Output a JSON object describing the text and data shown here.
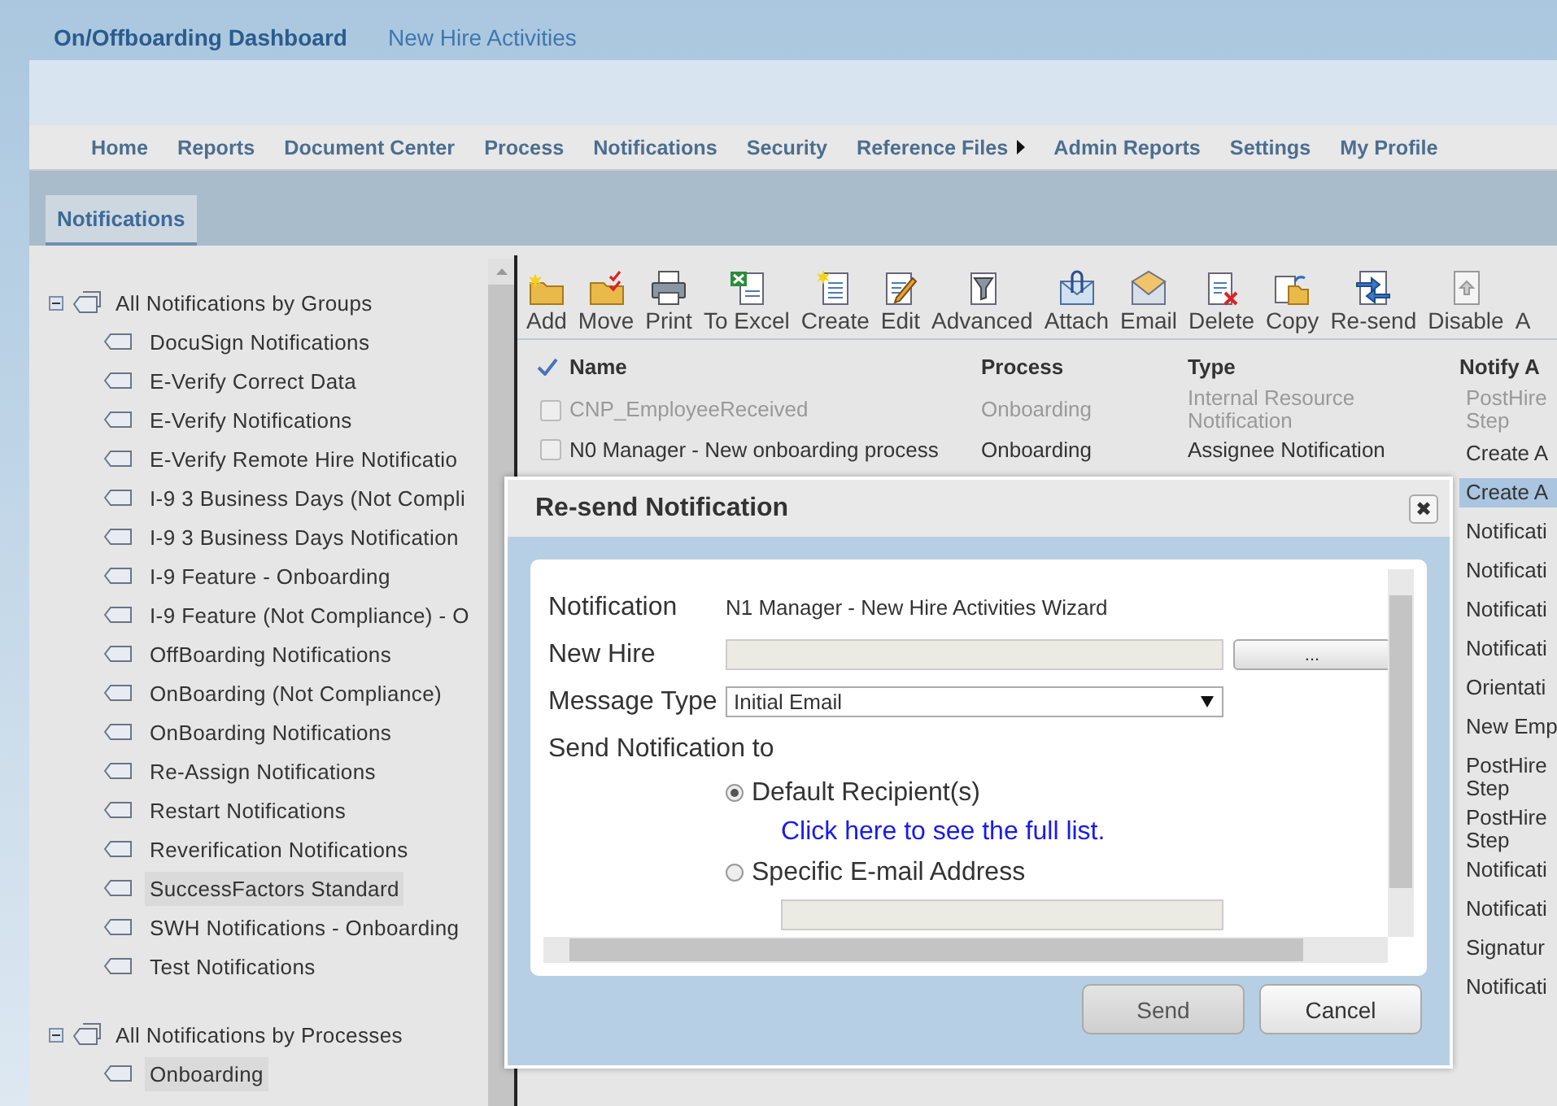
{
  "header": {
    "title": "On/Offboarding Dashboard",
    "subtitle": "New Hire Activities"
  },
  "nav": [
    {
      "label": "Home",
      "submenu": false
    },
    {
      "label": "Reports",
      "submenu": false
    },
    {
      "label": "Document Center",
      "submenu": false
    },
    {
      "label": "Process",
      "submenu": false
    },
    {
      "label": "Notifications",
      "submenu": false
    },
    {
      "label": "Security",
      "submenu": false
    },
    {
      "label": "Reference Files",
      "submenu": true
    },
    {
      "label": "Admin Reports",
      "submenu": false
    },
    {
      "label": "Settings",
      "submenu": false
    },
    {
      "label": "My Profile",
      "submenu": false
    }
  ],
  "tabs": [
    {
      "label": "Notifications",
      "selected": true
    }
  ],
  "tree": [
    {
      "label": "All Notifications by Groups",
      "expanded": true,
      "selected": false,
      "children": [
        {
          "label": "DocuSign Notifications",
          "selected": false
        },
        {
          "label": "E-Verify Correct Data",
          "selected": false
        },
        {
          "label": "E-Verify Notifications",
          "selected": false
        },
        {
          "label": "E-Verify Remote Hire Notificatio",
          "selected": false
        },
        {
          "label": "I-9 3 Business Days (Not Compli",
          "selected": false
        },
        {
          "label": "I-9 3 Business Days Notification",
          "selected": false
        },
        {
          "label": "I-9 Feature - Onboarding",
          "selected": false
        },
        {
          "label": "I-9 Feature (Not Compliance) - O",
          "selected": false
        },
        {
          "label": "OffBoarding Notifications",
          "selected": false
        },
        {
          "label": "OnBoarding (Not Compliance)",
          "selected": false
        },
        {
          "label": "OnBoarding Notifications",
          "selected": false
        },
        {
          "label": "Re-Assign Notifications",
          "selected": false
        },
        {
          "label": "Restart Notifications",
          "selected": false
        },
        {
          "label": "Reverification Notifications",
          "selected": false
        },
        {
          "label": "SuccessFactors Standard",
          "selected": true
        },
        {
          "label": "SWH Notifications - Onboarding",
          "selected": false
        },
        {
          "label": "Test Notifications",
          "selected": false
        }
      ]
    },
    {
      "label": "All Notifications by Processes",
      "expanded": true,
      "selected": false,
      "children": [
        {
          "label": "Onboarding",
          "selected": true
        }
      ]
    }
  ],
  "toolbar": [
    {
      "label": "Add"
    },
    {
      "label": "Move"
    },
    {
      "label": "Print"
    },
    {
      "label": "To Excel"
    },
    {
      "label": "Create"
    },
    {
      "label": "Edit"
    },
    {
      "label": "Advanced"
    },
    {
      "label": "Attach"
    },
    {
      "label": "Email"
    },
    {
      "label": "Delete"
    },
    {
      "label": "Copy"
    },
    {
      "label": "Re-send"
    },
    {
      "label": "Disable"
    },
    {
      "label": "A"
    }
  ],
  "table": {
    "columns": [
      "Name",
      "Process",
      "Type",
      "Notify A"
    ],
    "rows": [
      {
        "name": "CNP_EmployeeReceived",
        "process": "Onboarding",
        "type": "Internal Resource Notification",
        "notify": "PostHire Step",
        "disabled": true,
        "selected": false,
        "checked": false
      },
      {
        "name": "N0 Manager - New onboarding process",
        "process": "Onboarding",
        "type": "Assignee Notification",
        "notify": "Create A",
        "disabled": false,
        "selected": false,
        "checked": false
      },
      {
        "notify": "Create A",
        "disabled": false,
        "selected": true
      },
      {
        "notify": "Notificati",
        "disabled": false,
        "selected": false
      },
      {
        "notify": "Notificati",
        "disabled": false,
        "selected": false
      },
      {
        "notify": "Notificati",
        "disabled": false,
        "selected": false
      },
      {
        "notify": "Notificati",
        "disabled": false,
        "selected": false
      },
      {
        "notify": "Orientati",
        "disabled": false,
        "selected": false
      },
      {
        "notify": "New Emp",
        "disabled": false,
        "selected": false
      },
      {
        "notify": "PostHire Step",
        "disabled": false,
        "selected": false
      },
      {
        "notify": "PostHire Step",
        "disabled": false,
        "selected": false
      },
      {
        "notify": "Notificati",
        "disabled": false,
        "selected": false
      },
      {
        "notify": "Notificati",
        "disabled": false,
        "selected": false
      },
      {
        "notify": "Signatur",
        "disabled": false,
        "selected": false
      },
      {
        "notify": "Notificati",
        "disabled": false,
        "selected": false
      }
    ]
  },
  "dialog": {
    "title": "Re-send Notification",
    "close": "✖",
    "notification_label": "Notification",
    "notification_value": "N1 Manager - New Hire Activities Wizard",
    "new_hire_label": "New Hire",
    "browse_button": "...",
    "message_type_label": "Message Type",
    "message_type": "Initial Email",
    "send_to_label": "Send Notification to",
    "recipients": [
      {
        "label": "Default Recipient(s)",
        "selected": true,
        "link": "Click here to see the full list."
      },
      {
        "label": "Specific E-mail Address",
        "selected": false
      }
    ],
    "buttons": [
      {
        "label": "Send",
        "primary": true
      },
      {
        "label": "Cancel",
        "primary": false
      }
    ]
  }
}
